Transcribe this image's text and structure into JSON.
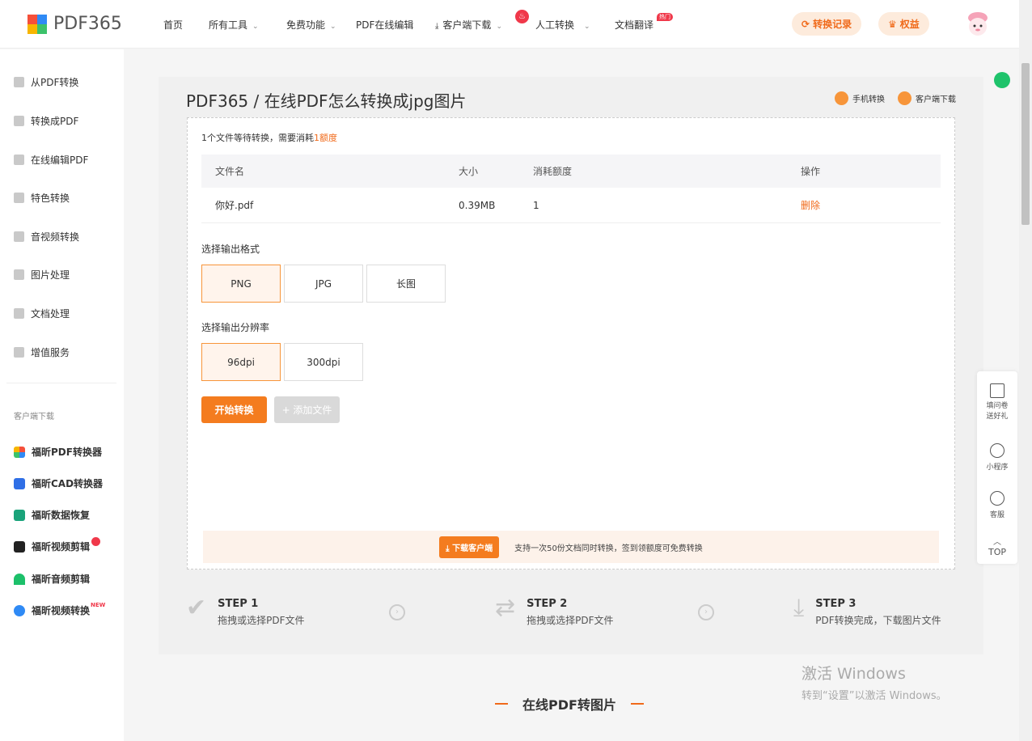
{
  "logo": {
    "text": "PDF365"
  },
  "nav": {
    "items": [
      {
        "label": "首页"
      },
      {
        "label": "所有工具"
      },
      {
        "label": "免费功能"
      },
      {
        "label": "PDF在线编辑"
      },
      {
        "label": "客户端下载"
      },
      {
        "label": "人工转换"
      },
      {
        "label": "文档翻译",
        "badge": "热门"
      }
    ],
    "history_label": "转换记录",
    "benefits_label": "权益"
  },
  "sidebar": {
    "items": [
      {
        "label": "从PDF转换"
      },
      {
        "label": "转换成PDF"
      },
      {
        "label": "在线编辑PDF"
      },
      {
        "label": "特色转换"
      },
      {
        "label": "音视频转换"
      },
      {
        "label": "图片处理"
      },
      {
        "label": "文档处理"
      },
      {
        "label": "增值服务"
      }
    ],
    "section_title": "客户端下载",
    "apps": [
      {
        "label": "福昕PDF转换器"
      },
      {
        "label": "福昕CAD转换器"
      },
      {
        "label": "福昕数据恢复"
      },
      {
        "label": "福昕视频剪辑"
      },
      {
        "label": "福昕音频剪辑"
      },
      {
        "label": "福昕视频转换",
        "tag": "NEW"
      }
    ]
  },
  "main": {
    "title": "PDF365 / 在线PDF怎么转换成jpg图片",
    "mobile_label": "手机转换",
    "client_label": "客户端下载",
    "pending_prefix": "1个文件等待转换，需要消耗",
    "pending_amount": "1额度",
    "table": {
      "headers": [
        "文件名",
        "大小",
        "消耗额度",
        "操作"
      ],
      "rows": [
        {
          "name": "你好.pdf",
          "size": "0.39MB",
          "cost": "1",
          "action": "删除"
        }
      ]
    },
    "format_label": "选择输出格式",
    "formats": [
      "PNG",
      "JPG",
      "长图"
    ],
    "resolution_label": "选择输出分辨率",
    "resolutions": [
      "96dpi",
      "300dpi"
    ],
    "start_label": "开始转换",
    "add_label": "+ 添加文件",
    "banner_button": "下载客户端",
    "banner_text": "支持一次50份文档同时转换，签到领额度可免费转换"
  },
  "steps": [
    {
      "title": "STEP 1",
      "desc": "拖拽或选择PDF文件"
    },
    {
      "title": "STEP 2",
      "desc": "拖拽或选择PDF文件"
    },
    {
      "title": "STEP 3",
      "desc": "PDF转换完成，下载图片文件"
    }
  ],
  "section_heading": "在线PDF转图片",
  "watermark": {
    "line1": "激活 Windows",
    "line2": "转到“设置”以激活 Windows。"
  },
  "float": {
    "survey": "填问卷送好礼",
    "mini": "小程序",
    "service": "客服",
    "top": "TOP"
  }
}
